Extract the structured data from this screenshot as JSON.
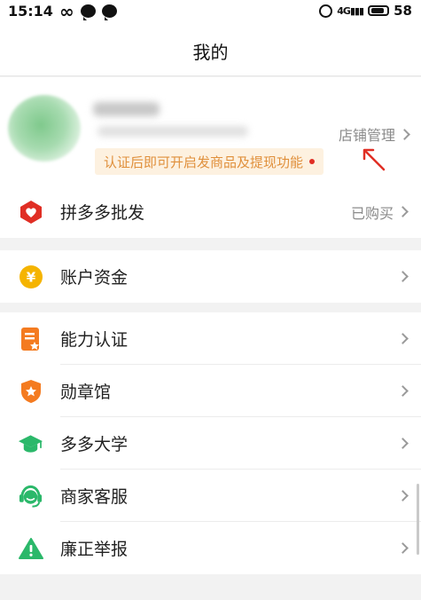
{
  "status_bar": {
    "time": "15:14",
    "network": "4G",
    "battery_level": "58"
  },
  "header": {
    "title": "我的"
  },
  "profile": {
    "shop_manage_label": "店铺管理",
    "notice_text": "认证后即可开启发商品及提现功能"
  },
  "wholesale": {
    "label": "拼多多批发",
    "status": "已购买"
  },
  "funds": {
    "label": "账户资金"
  },
  "menu": {
    "items": [
      {
        "label": "能力认证",
        "icon": "certificate-icon",
        "color": "#f47b20"
      },
      {
        "label": "勋章馆",
        "icon": "medal-shield-icon",
        "color": "#f47b20"
      },
      {
        "label": "多多大学",
        "icon": "graduation-cap-icon",
        "color": "#2bb86a"
      },
      {
        "label": "商家客服",
        "icon": "headset-icon",
        "color": "#2bb86a"
      },
      {
        "label": "廉正举报",
        "icon": "warning-icon",
        "color": "#2bb86a"
      }
    ]
  },
  "colors": {
    "accent_red": "#e02e24",
    "orange": "#f47b20",
    "yellow": "#f5b400",
    "green": "#2bb86a",
    "notice_bg": "#fdf1e0",
    "notice_text": "#e0903c"
  }
}
